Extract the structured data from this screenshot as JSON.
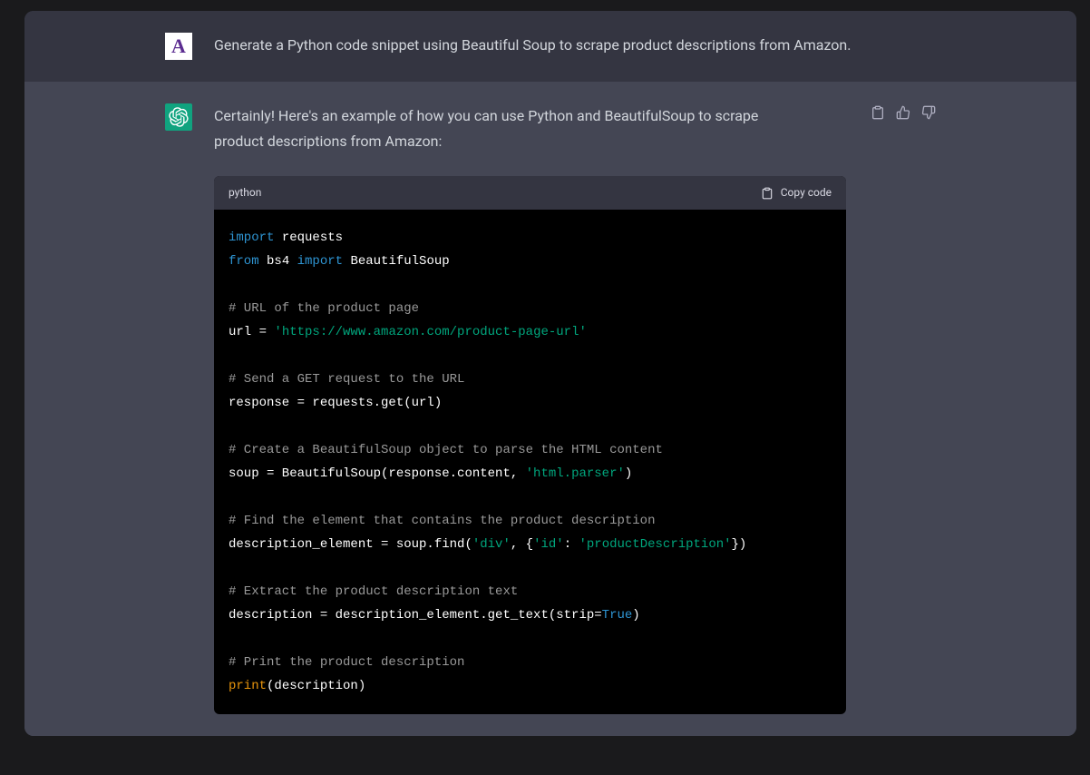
{
  "user_avatar_letter": "A",
  "user_message": "Generate a Python code snippet using Beautiful Soup to scrape product descriptions from Amazon.",
  "assistant_intro": "Certainly! Here's an example of how you can use Python and BeautifulSoup to scrape product descriptions from Amazon:",
  "code": {
    "language": "python",
    "copy_label": "Copy code",
    "tokens": [
      {
        "t": "import",
        "c": "keyword"
      },
      {
        "t": " requests\n",
        "c": "white"
      },
      {
        "t": "from",
        "c": "keyword"
      },
      {
        "t": " bs4 ",
        "c": "white"
      },
      {
        "t": "import",
        "c": "keyword"
      },
      {
        "t": " BeautifulSoup\n",
        "c": "white"
      },
      {
        "t": "\n",
        "c": "white"
      },
      {
        "t": "# URL of the product page\n",
        "c": "comment"
      },
      {
        "t": "url = ",
        "c": "white"
      },
      {
        "t": "'https://www.amazon.com/product-page-url'",
        "c": "string"
      },
      {
        "t": "\n",
        "c": "white"
      },
      {
        "t": "\n",
        "c": "white"
      },
      {
        "t": "# Send a GET request to the URL\n",
        "c": "comment"
      },
      {
        "t": "response = requests.get(url)\n",
        "c": "white"
      },
      {
        "t": "\n",
        "c": "white"
      },
      {
        "t": "# Create a BeautifulSoup object to parse the HTML content\n",
        "c": "comment"
      },
      {
        "t": "soup = BeautifulSoup(response.content, ",
        "c": "white"
      },
      {
        "t": "'html.parser'",
        "c": "string"
      },
      {
        "t": ")\n",
        "c": "white"
      },
      {
        "t": "\n",
        "c": "white"
      },
      {
        "t": "# Find the element that contains the product description\n",
        "c": "comment"
      },
      {
        "t": "description_element = soup.find(",
        "c": "white"
      },
      {
        "t": "'div'",
        "c": "string"
      },
      {
        "t": ", {",
        "c": "white"
      },
      {
        "t": "'id'",
        "c": "string"
      },
      {
        "t": ": ",
        "c": "white"
      },
      {
        "t": "'productDescription'",
        "c": "string"
      },
      {
        "t": "})\n",
        "c": "white"
      },
      {
        "t": "\n",
        "c": "white"
      },
      {
        "t": "# Extract the product description text\n",
        "c": "comment"
      },
      {
        "t": "description = description_element.get_text(strip=",
        "c": "white"
      },
      {
        "t": "True",
        "c": "bool"
      },
      {
        "t": ")\n",
        "c": "white"
      },
      {
        "t": "\n",
        "c": "white"
      },
      {
        "t": "# Print the product description\n",
        "c": "comment"
      },
      {
        "t": "print",
        "c": "builtin"
      },
      {
        "t": "(description)",
        "c": "white"
      }
    ]
  }
}
